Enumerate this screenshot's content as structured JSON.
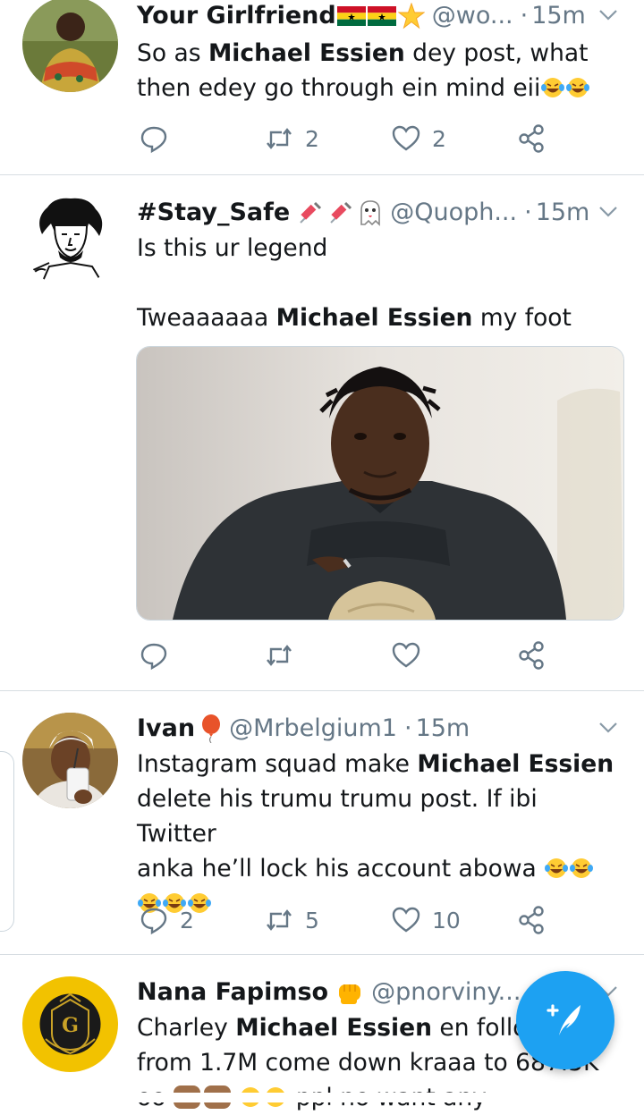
{
  "colors": {
    "accent": "#1da1f2",
    "muted": "#657786",
    "divider": "#d7dde2"
  },
  "tweets": [
    {
      "name": "Your Girlfriend",
      "handle": "@wo...",
      "time": "15m",
      "text_lines": [
        [
          "So as ",
          "Michael Essien",
          " dey post, what"
        ],
        [
          "then edey go through ein mind eii",
          "",
          ""
        ]
      ],
      "actions": {
        "reply": "",
        "retweet": "2",
        "like": "2"
      }
    },
    {
      "name": "#Stay_Safe",
      "handle": "@Quoph...",
      "time": "15m",
      "line1": "Is this ur legend",
      "line2_pre": "Tweaaaaaa ",
      "line2_bold": "Michael Essien",
      "line2_post": " my foot",
      "actions": {
        "reply": "",
        "retweet": "",
        "like": ""
      }
    },
    {
      "name": "Ivan",
      "handle": "@Mrbelgium1",
      "time": "15m",
      "line1_pre": "Instagram squad make ",
      "line1_bold": "Michael Essien",
      "line2": "delete his trumu trumu post. If ibi Twitter",
      "line3": "anka he’ll lock his account abowa",
      "actions": {
        "reply": "2",
        "retweet": "5",
        "like": "10"
      }
    },
    {
      "name": "Nana Fapimso",
      "handle": "@pnorviny...",
      "time": "",
      "line1_pre": "Charley ",
      "line1_bold": "Michael Essien",
      "line1_post": " en follow",
      "line2": "from 1.7M come down kraaa to 687.5K",
      "line3": "oo",
      "line3_post": "ppl no want any"
    }
  ],
  "icons": [
    "chevron-down-icon",
    "reply-icon",
    "retweet-icon",
    "like-icon",
    "share-icon",
    "compose-icon"
  ]
}
